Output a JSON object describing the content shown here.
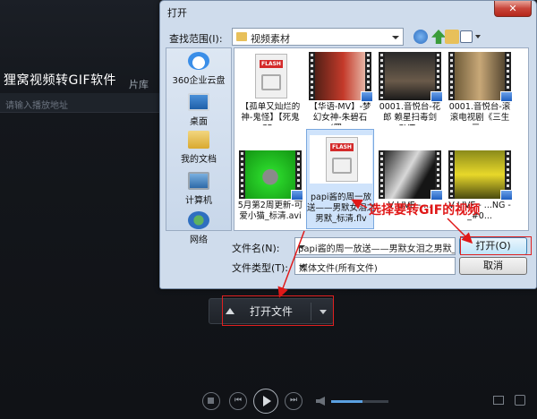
{
  "player": {
    "app_title": "狸窝视频转GIF软件",
    "library_tab": "片库",
    "address_placeholder": "请输入播放地址",
    "open_file_label": "打开文件",
    "volume_level": 0.55
  },
  "annotation": {
    "text": "选择要转GIF的视频"
  },
  "dialog": {
    "title": "打开",
    "close_glyph": "✕",
    "lookin_label": "查找范围(I):",
    "lookin_value": "视频素材",
    "places": [
      {
        "label": "360企业云盘",
        "icon": "cloud-icon"
      },
      {
        "label": "桌面",
        "icon": "desktop-icon"
      },
      {
        "label": "我的文档",
        "icon": "documents-icon"
      },
      {
        "label": "计算机",
        "icon": "computer-icon"
      },
      {
        "label": "网络",
        "icon": "network-icon"
      }
    ],
    "files": [
      {
        "name": "【孤单又灿烂的神-鬼怪】【死鬼CP...",
        "kind": "flash"
      },
      {
        "name": "【华语-MV】-梦幻女神-朱碧石(罗...",
        "kind": "video-red"
      },
      {
        "name": "0001.音悦台-花郎 赖星扫毒剑CUT...",
        "kind": "video-dark"
      },
      {
        "name": "0001.音悦台-滚滚电视剧《三生三...",
        "kind": "video-scene"
      },
      {
        "name": "5月第2周更新-可爱小猫_标清.avi",
        "kind": "video-cat"
      },
      {
        "name": "papi酱的周一放送——男默女泪之男默_标清.flv",
        "kind": "flash"
      },
      {
        "name": "V LIVE - ...",
        "kind": "video-bw"
      },
      {
        "name": "V LIVE - ...NG - _#0...",
        "kind": "video-yellow"
      }
    ],
    "filename_label": "文件名(N):",
    "filename_value": "papi酱的周一放送——男默女泪之男默_标",
    "filetype_label": "文件类型(T):",
    "filetype_value": "媒体文件(所有文件)",
    "open_button": "打开(O)",
    "cancel_button": "取消"
  }
}
